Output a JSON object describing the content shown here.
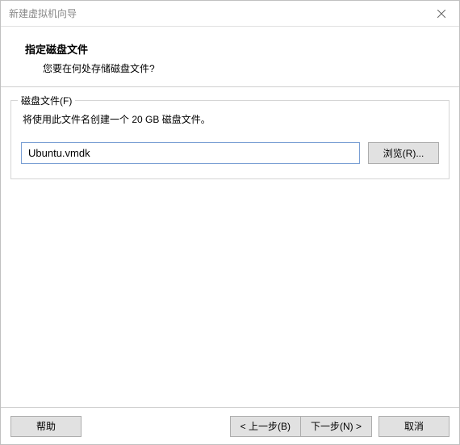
{
  "titlebar": {
    "title": "新建虚拟机向导"
  },
  "header": {
    "title": "指定磁盘文件",
    "desc": "您要在何处存储磁盘文件?"
  },
  "group": {
    "title": "磁盘文件(F)",
    "desc": "将使用此文件名创建一个 20 GB 磁盘文件。",
    "input_value": "Ubuntu.vmdk",
    "browse_label": "浏览(R)..."
  },
  "footer": {
    "help_label": "帮助",
    "back_label": "< 上一步(B)",
    "next_label": "下一步(N) >",
    "cancel_label": "取消"
  }
}
